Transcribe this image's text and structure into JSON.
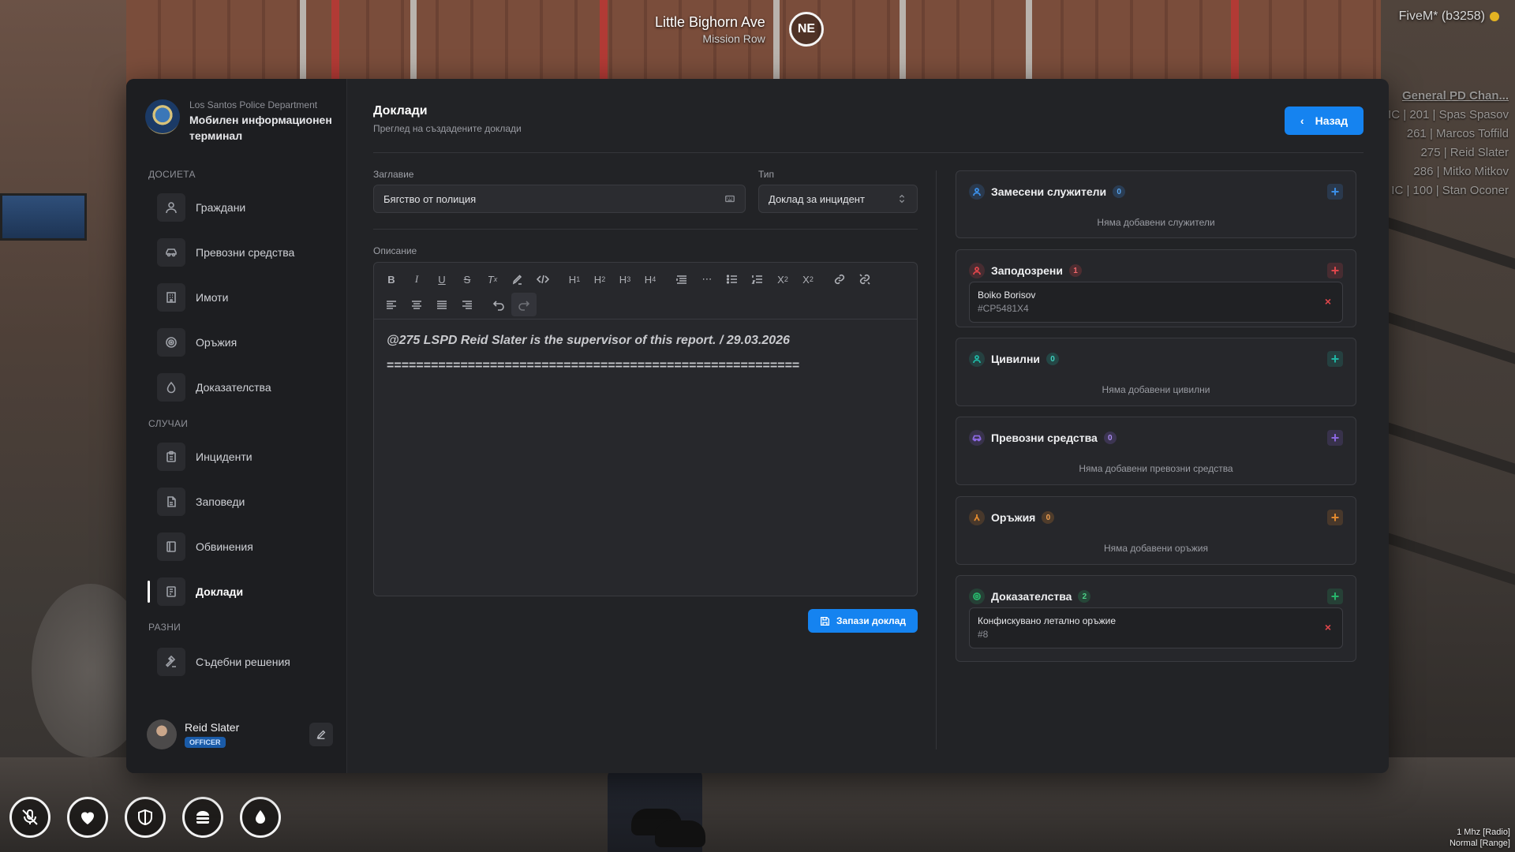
{
  "hud": {
    "street": "Little Bighorn Ave",
    "area": "Mission Row",
    "compass": "NE",
    "server": "FiveM* (b3258)",
    "radio_line1": "1 Mhz [Radio]",
    "radio_line2": "Normal [Range]",
    "chain": {
      "title": "General PD Chan...",
      "members": [
        "IC | 201 | Spas Spasov",
        "261 | Marcos Toffild",
        "275 | Reid Slater",
        "286 | Mitko Mitkov",
        "IC | 100 | Stan Oconer"
      ]
    },
    "status_icons": [
      "mic-muted-icon",
      "health-icon",
      "armor-icon",
      "hunger-icon",
      "thirst-icon"
    ]
  },
  "sidebar": {
    "dept": "Los Santos Police Department",
    "title": "Мобилен информационен терминал",
    "sections": {
      "dossiers": "ДОСИЕТА",
      "cases": "СЛУЧАИ",
      "misc": "РАЗНИ"
    },
    "items": [
      {
        "label": "Граждани",
        "icon": "user-icon"
      },
      {
        "label": "Превозни средства",
        "icon": "car-icon"
      },
      {
        "label": "Имоти",
        "icon": "building-icon"
      },
      {
        "label": "Оръжия",
        "icon": "target-icon"
      },
      {
        "label": "Доказателства",
        "icon": "drop-icon"
      },
      {
        "label": "Инциденти",
        "icon": "clipboard-icon"
      },
      {
        "label": "Заповеди",
        "icon": "file-icon"
      },
      {
        "label": "Обвинения",
        "icon": "book-icon"
      },
      {
        "label": "Доклади",
        "icon": "report-icon",
        "active": true
      },
      {
        "label": "Съдебни решения",
        "icon": "gavel-icon"
      }
    ],
    "user": {
      "name": "Reid Slater",
      "role": "OFFICER"
    }
  },
  "main": {
    "title": "Доклади",
    "subtitle": "Преглед на създадените доклади",
    "back_label": "Назад",
    "title_label": "Заглавие",
    "title_value": "Бягство от полиция",
    "type_label": "Тип",
    "type_value": "Доклад за инцидент",
    "description_label": "Описание",
    "editor": {
      "toolbar_row1": [
        "B",
        "I",
        "U",
        "S",
        "Tx",
        "highlight",
        "code",
        "H1",
        "H2",
        "H3",
        "H4",
        "quote",
        "hr",
        "bullet-list",
        "ordered-list",
        "X₂",
        "X²",
        "link",
        "unlink"
      ],
      "toolbar_row2": [
        "align-left",
        "align-center",
        "align-justify",
        "align-right",
        "undo",
        "redo"
      ],
      "line1": "@275 LSPD Reid Slater is the supervisor of this report. / 29.03.2026",
      "line2": "========================================================"
    },
    "save_label": "Запази доклад"
  },
  "cards": [
    {
      "key": "officers",
      "title": "Замесени служители",
      "count": "0",
      "empty": "Няма добавени служители",
      "color": "#3b8fe8",
      "icon": "officer-icon"
    },
    {
      "key": "suspects",
      "title": "Заподозрени",
      "count": "1",
      "color": "#e0464b",
      "icon": "suspect-icon",
      "entries": [
        {
          "name": "Boiko Borisov",
          "id": "#CP5481X4"
        }
      ]
    },
    {
      "key": "civilians",
      "title": "Цивилни",
      "count": "0",
      "empty": "Няма добавени цивилни",
      "color": "#1fb5a3",
      "icon": "civilian-icon"
    },
    {
      "key": "vehicles",
      "title": "Превозни средства",
      "count": "0",
      "empty": "Няма добавени превозни средства",
      "color": "#8b67e0",
      "icon": "vehicle-icon"
    },
    {
      "key": "weapons",
      "title": "Оръжия",
      "count": "0",
      "empty": "Няма добавени оръжия",
      "color": "#e38a2e",
      "icon": "weapon-icon"
    },
    {
      "key": "evidence",
      "title": "Доказателства",
      "count": "2",
      "color": "#27b66b",
      "icon": "evidence-icon",
      "entries": [
        {
          "name": "Конфискувано летално оръжие",
          "id": "#8"
        }
      ]
    }
  ],
  "colors": {
    "accent": "#1583f0",
    "panel": "#222326",
    "sidebar": "#1d1e21"
  }
}
